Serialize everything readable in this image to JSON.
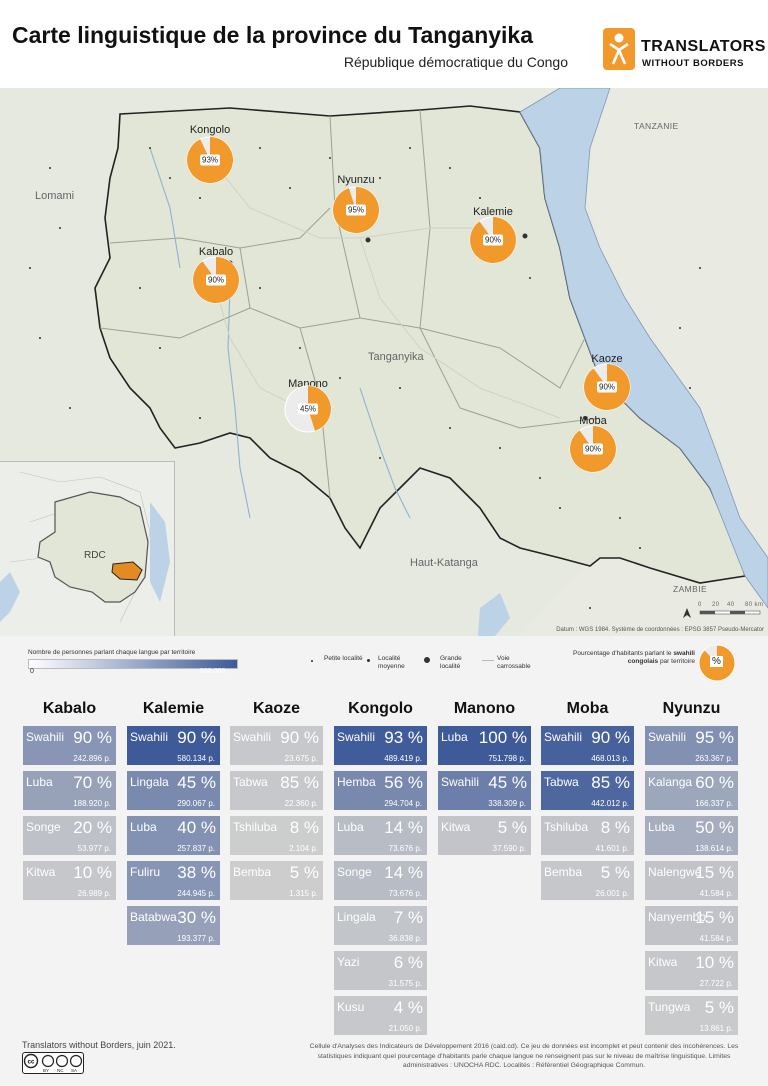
{
  "title": "Carte linguistique de la province du Tanganyika",
  "subtitle": "République démocratique du Congo",
  "logo": {
    "line1": "TRANSLATORS",
    "line2": "WITHOUT BORDERS",
    "color": "#f19a2b",
    "icon": "twb-person-icon"
  },
  "map": {
    "labels": {
      "lomami": "Lomami",
      "tanzanie": "TANZANIE",
      "zambie": "ZAMBIE",
      "tanganyika": "Tanganyika",
      "haut_katanga": "Haut-Katanga",
      "rdc": "RDC"
    },
    "credit": "Datum : WGS 1984. Système de coordonnées : EPSG 3857 Pseudo-Mercator",
    "scale_labels": [
      "0",
      "20",
      "40",
      "80 km"
    ],
    "territories": [
      {
        "name": "Kongolo",
        "swahili_pct": 93,
        "label": "93%"
      },
      {
        "name": "Nyunzu",
        "swahili_pct": 95,
        "label": "95%"
      },
      {
        "name": "Kalemie",
        "swahili_pct": 90,
        "label": "90%"
      },
      {
        "name": "Kabalo",
        "swahili_pct": 90,
        "label": "90%"
      },
      {
        "name": "Manono",
        "swahili_pct": 45,
        "label": "45%"
      },
      {
        "name": "Kaoze",
        "swahili_pct": 90,
        "label": "90%"
      },
      {
        "name": "Moba",
        "swahili_pct": 90,
        "label": "90%"
      }
    ],
    "colors": {
      "land": "#e1e6d6",
      "lake": "#bcd2e6",
      "pie_fill": "#f19a2b",
      "pie_rest": "#ececec",
      "inset_highlight": "#e48a23"
    }
  },
  "legend": {
    "gradient_label": "Nombre de personnes parlant chaque langue par territoire",
    "gradient_min": "0",
    "gradient_max": "500.000",
    "small_locality": "Petite localité",
    "medium_locality": "Localité moyenne",
    "large_locality": "Grande localité",
    "road": "Voie carrossable",
    "pie_label_pre": "Pourcentage d'habitants parlant le ",
    "pie_label_bold": "swahili congolais",
    "pie_label_post": " par territoire",
    "pie_symbol": "%",
    "colors": {
      "gradient_start": "#ffffff",
      "gradient_end": "#3e5a99"
    }
  },
  "territories_table": [
    {
      "name": "Kabalo",
      "languages": [
        {
          "lang": "Swahili",
          "pct": "90 %",
          "pop": "242.896 p.",
          "people": 242896
        },
        {
          "lang": "Luba",
          "pct": "70 %",
          "pop": "188.920 p.",
          "people": 188920
        },
        {
          "lang": "Songe",
          "pct": "20 %",
          "pop": "53.977 p.",
          "people": 53977
        },
        {
          "lang": "Kitwa",
          "pct": "10 %",
          "pop": "26.989 p.",
          "people": 26989
        }
      ]
    },
    {
      "name": "Kalemie",
      "languages": [
        {
          "lang": "Swahili",
          "pct": "90 %",
          "pop": "580.134 p.",
          "people": 580134
        },
        {
          "lang": "Lingala",
          "pct": "45 %",
          "pop": "290.067 p.",
          "people": 290067
        },
        {
          "lang": "Luba",
          "pct": "40 %",
          "pop": "257.837 p.",
          "people": 257837
        },
        {
          "lang": "Fuliru",
          "pct": "38 %",
          "pop": "244.945 p.",
          "people": 244945
        },
        {
          "lang": "Batabwa",
          "pct": "30 %",
          "pop": "193.377 p.",
          "people": 193377
        }
      ]
    },
    {
      "name": "Kaoze",
      "languages": [
        {
          "lang": "Swahili",
          "pct": "90 %",
          "pop": "23.675 p.",
          "people": 23675
        },
        {
          "lang": "Tabwa",
          "pct": "85 %",
          "pop": "22.360 p.",
          "people": 22360
        },
        {
          "lang": "Tshiluba",
          "pct": "8 %",
          "pop": "2.104 p.",
          "people": 2104
        },
        {
          "lang": "Bemba",
          "pct": "5 %",
          "pop": "1.315 p.",
          "people": 1315
        }
      ]
    },
    {
      "name": "Kongolo",
      "languages": [
        {
          "lang": "Swahili",
          "pct": "93 %",
          "pop": "489.419 p.",
          "people": 489419
        },
        {
          "lang": "Hemba",
          "pct": "56 %",
          "pop": "294.704 p.",
          "people": 294704
        },
        {
          "lang": "Luba",
          "pct": "14 %",
          "pop": "73.676 p.",
          "people": 73676
        },
        {
          "lang": "Songe",
          "pct": "14 %",
          "pop": "73.676 p.",
          "people": 73676
        },
        {
          "lang": "Lingala",
          "pct": "7 %",
          "pop": "36.838 p.",
          "people": 36838
        },
        {
          "lang": "Yazi",
          "pct": "6 %",
          "pop": "31.575 p.",
          "people": 31575
        },
        {
          "lang": "Kusu",
          "pct": "4 %",
          "pop": "21.050 p.",
          "people": 21050
        }
      ]
    },
    {
      "name": "Manono",
      "languages": [
        {
          "lang": "Luba",
          "pct": "100 %",
          "pop": "751.798 p.",
          "people": 751798
        },
        {
          "lang": "Swahili",
          "pct": "45 %",
          "pop": "338.309 p.",
          "people": 338309
        },
        {
          "lang": "Kitwa",
          "pct": "5 %",
          "pop": "37.590 p.",
          "people": 37590
        }
      ]
    },
    {
      "name": "Moba",
      "languages": [
        {
          "lang": "Swahili",
          "pct": "90 %",
          "pop": "468.013 p.",
          "people": 468013
        },
        {
          "lang": "Tabwa",
          "pct": "85 %",
          "pop": "442.012 p.",
          "people": 442012
        },
        {
          "lang": "Tshiluba",
          "pct": "8 %",
          "pop": "41.601 p.",
          "people": 41601
        },
        {
          "lang": "Bemba",
          "pct": "5 %",
          "pop": "26.001 p.",
          "people": 26001
        }
      ]
    },
    {
      "name": "Nyunzu",
      "languages": [
        {
          "lang": "Swahili",
          "pct": "95 %",
          "pop": "263.367 p.",
          "people": 263367
        },
        {
          "lang": "Kalanga",
          "pct": "60 %",
          "pop": "166.337 p.",
          "people": 166337
        },
        {
          "lang": "Luba",
          "pct": "50 %",
          "pop": "138.614 p.",
          "people": 138614
        },
        {
          "lang": "Nalengwe",
          "pct": "15 %",
          "pop": "41.584 p.",
          "people": 41584
        },
        {
          "lang": "Nanyembo",
          "pct": "15 %",
          "pop": "41.584 p.",
          "people": 41584
        },
        {
          "lang": "Kitwa",
          "pct": "10 %",
          "pop": "27.722 p.",
          "people": 27722
        },
        {
          "lang": "Tungwa",
          "pct": "5 %",
          "pop": "13.861 p.",
          "people": 13861
        }
      ]
    }
  ],
  "footer": {
    "left": "Translators without Borders, juin 2021.",
    "cc": [
      "BY",
      "NC",
      "SA"
    ],
    "right": "Cellule d'Analyses des Indicateurs de Développement 2016 (caid.cd). Ce jeu de données est incomplet et peut contenir des incohérences. Les statistiques indiquant quel pourcentage d'habitants parle chaque langue ne renseignent pas sur le niveau de maîtrise linguistique. Limites administratives : UNOCHA RDC. Localités : Référentiel Géographique Commun."
  }
}
